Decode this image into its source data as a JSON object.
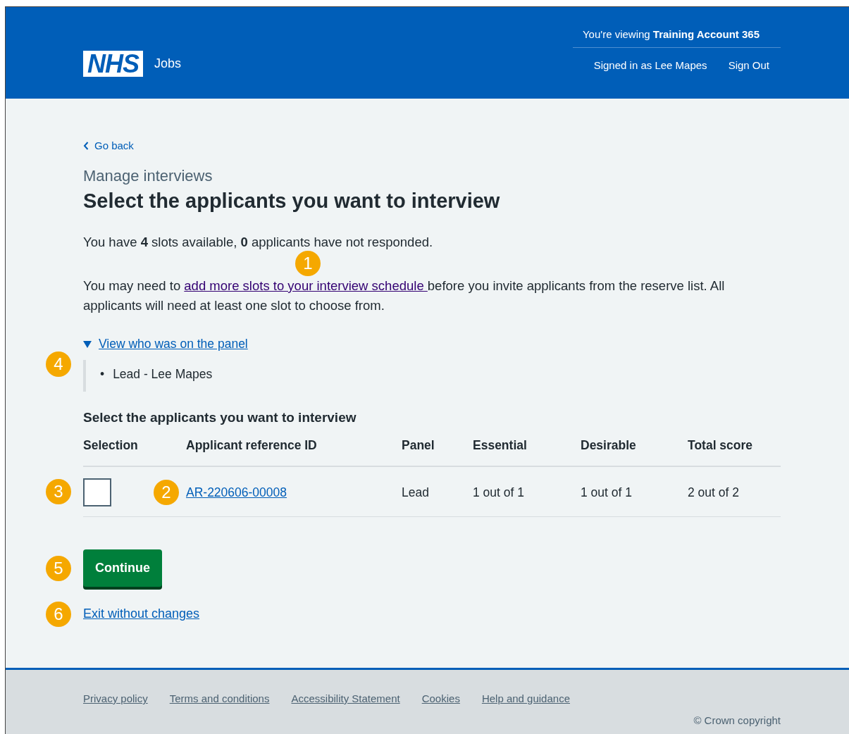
{
  "header": {
    "logo": "NHS",
    "service": "Jobs",
    "account": "You're viewing **Training Account 365**",
    "signed_in": "Signed in as Lee Mapes",
    "sign_out": "Sign Out"
  },
  "back_link": "Go back",
  "caption": "Manage interviews",
  "title": "Select the applicants you want to interview",
  "intro": "You have **4** slots available, **0** applicants have not responded.",
  "slots_note": {
    "before": "You may need to ",
    "link": "add more slots to your interview schedule ",
    "after": "before you invite applicants from the reserve list. All applicants will need at least one slot to choose from.",
    "callout": "1"
  },
  "details": {
    "summary": "View who was on the panel",
    "expanded": true,
    "callout": "4",
    "bullet": "•",
    "items": [
      "Lead - Lee Mapes"
    ]
  },
  "table": {
    "caption": "Select the applicants you want to interview",
    "columns": [
      "Selection",
      "Applicant reference ID",
      "Panel",
      "Essential",
      "Desirable",
      "Total score"
    ],
    "rows": [
      {
        "checked": false,
        "checkbox_callout": "3",
        "id": "AR-220606-00008",
        "id_callout": "2",
        "panel": "Lead",
        "essential": "1 out of 1",
        "desirable": "1 out of 1",
        "total": "2 out of 2"
      }
    ]
  },
  "continue_button": {
    "label": "Continue",
    "callout": "5"
  },
  "exit_link": {
    "label": "Exit without changes",
    "callout": "6"
  },
  "footer": {
    "links": [
      "Privacy policy",
      "Terms and conditions",
      "Accessibility Statement",
      "Cookies",
      "Help and guidance"
    ],
    "copyright": "© Crown copyright"
  }
}
